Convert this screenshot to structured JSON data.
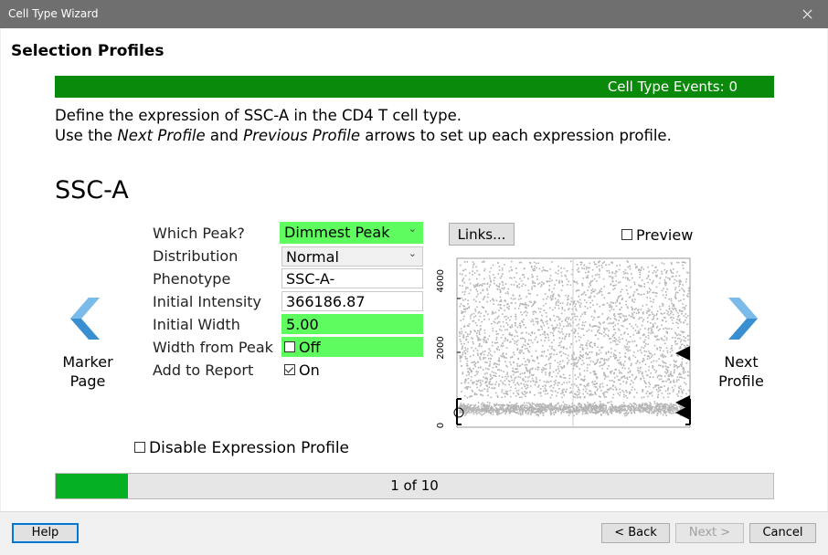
{
  "window": {
    "title": "Cell Type Wizard"
  },
  "page": {
    "heading": "Selection Profiles",
    "events_label": "Cell Type Events: 0",
    "instruction": {
      "line1": "Define the expression of SSC-A in the CD4 T cell type.",
      "line2_a": "Use the ",
      "line2_b": "Next Profile",
      "line2_c": " and ",
      "line2_d": "Previous Profile",
      "line2_e": " arrows to set up each expression profile."
    },
    "parameter": "SSC-A"
  },
  "form": {
    "which_peak": {
      "label": "Which Peak?",
      "value": "Dimmest Peak"
    },
    "distribution": {
      "label": "Distribution",
      "value": "Normal"
    },
    "phenotype": {
      "label": "Phenotype",
      "value": "SSC-A-"
    },
    "initial_intensity": {
      "label": "Initial Intensity",
      "value": "366186.87"
    },
    "initial_width": {
      "label": "Initial Width",
      "value": "5.00"
    },
    "width_from_peak": {
      "label": "Width from Peak",
      "value": "Off",
      "checked": false
    },
    "add_to_report": {
      "label": "Add to Report",
      "value": "On",
      "checked": true
    }
  },
  "links_label": "Links...",
  "preview_label": "Preview",
  "plot": {
    "y_ticks": [
      "4000",
      "2000",
      "0"
    ],
    "point_color": "#b4b4b4",
    "marker_color": "#000000"
  },
  "nav": {
    "prev_line1": "Marker",
    "prev_line2": "Page",
    "next_line1": "Next",
    "next_line2": "Profile",
    "arrow_color": "#3a8fd0"
  },
  "disable_label": "Disable Expression Profile",
  "progress": {
    "text": "1 of 10",
    "fraction": 0.1,
    "color": "#06b025"
  },
  "buttons": {
    "help": "Help",
    "back": "< Back",
    "next": "Next >",
    "cancel": "Cancel"
  },
  "colors": {
    "accent_green": "#0a8a0a",
    "highlight_green": "#5efc5e"
  }
}
